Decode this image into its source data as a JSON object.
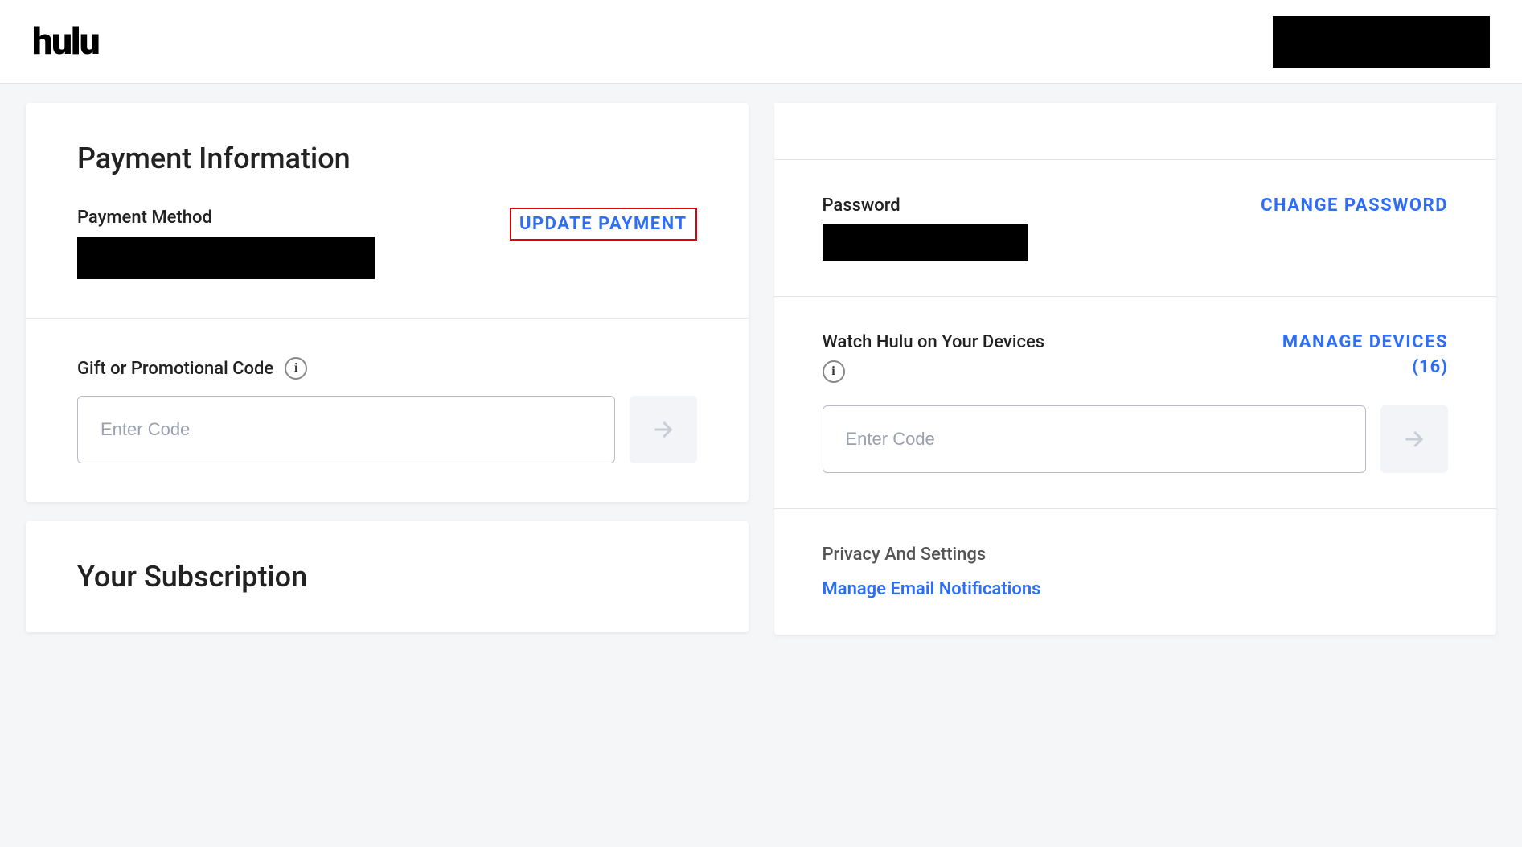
{
  "header": {
    "logo": "hulu"
  },
  "left": {
    "payment_info_title": "Payment Information",
    "payment_method_label": "Payment Method",
    "update_payment": "UPDATE PAYMENT",
    "promo_label": "Gift or Promotional Code",
    "promo_placeholder": "Enter Code",
    "subscription_title": "Your Subscription"
  },
  "right": {
    "password_label": "Password",
    "change_password": "CHANGE PASSWORD",
    "devices_label": "Watch Hulu on Your Devices",
    "manage_devices": "MANAGE DEVICES",
    "devices_count": "(16)",
    "devices_placeholder": "Enter Code",
    "privacy_title": "Privacy And Settings",
    "manage_email": "Manage Email Notifications"
  }
}
